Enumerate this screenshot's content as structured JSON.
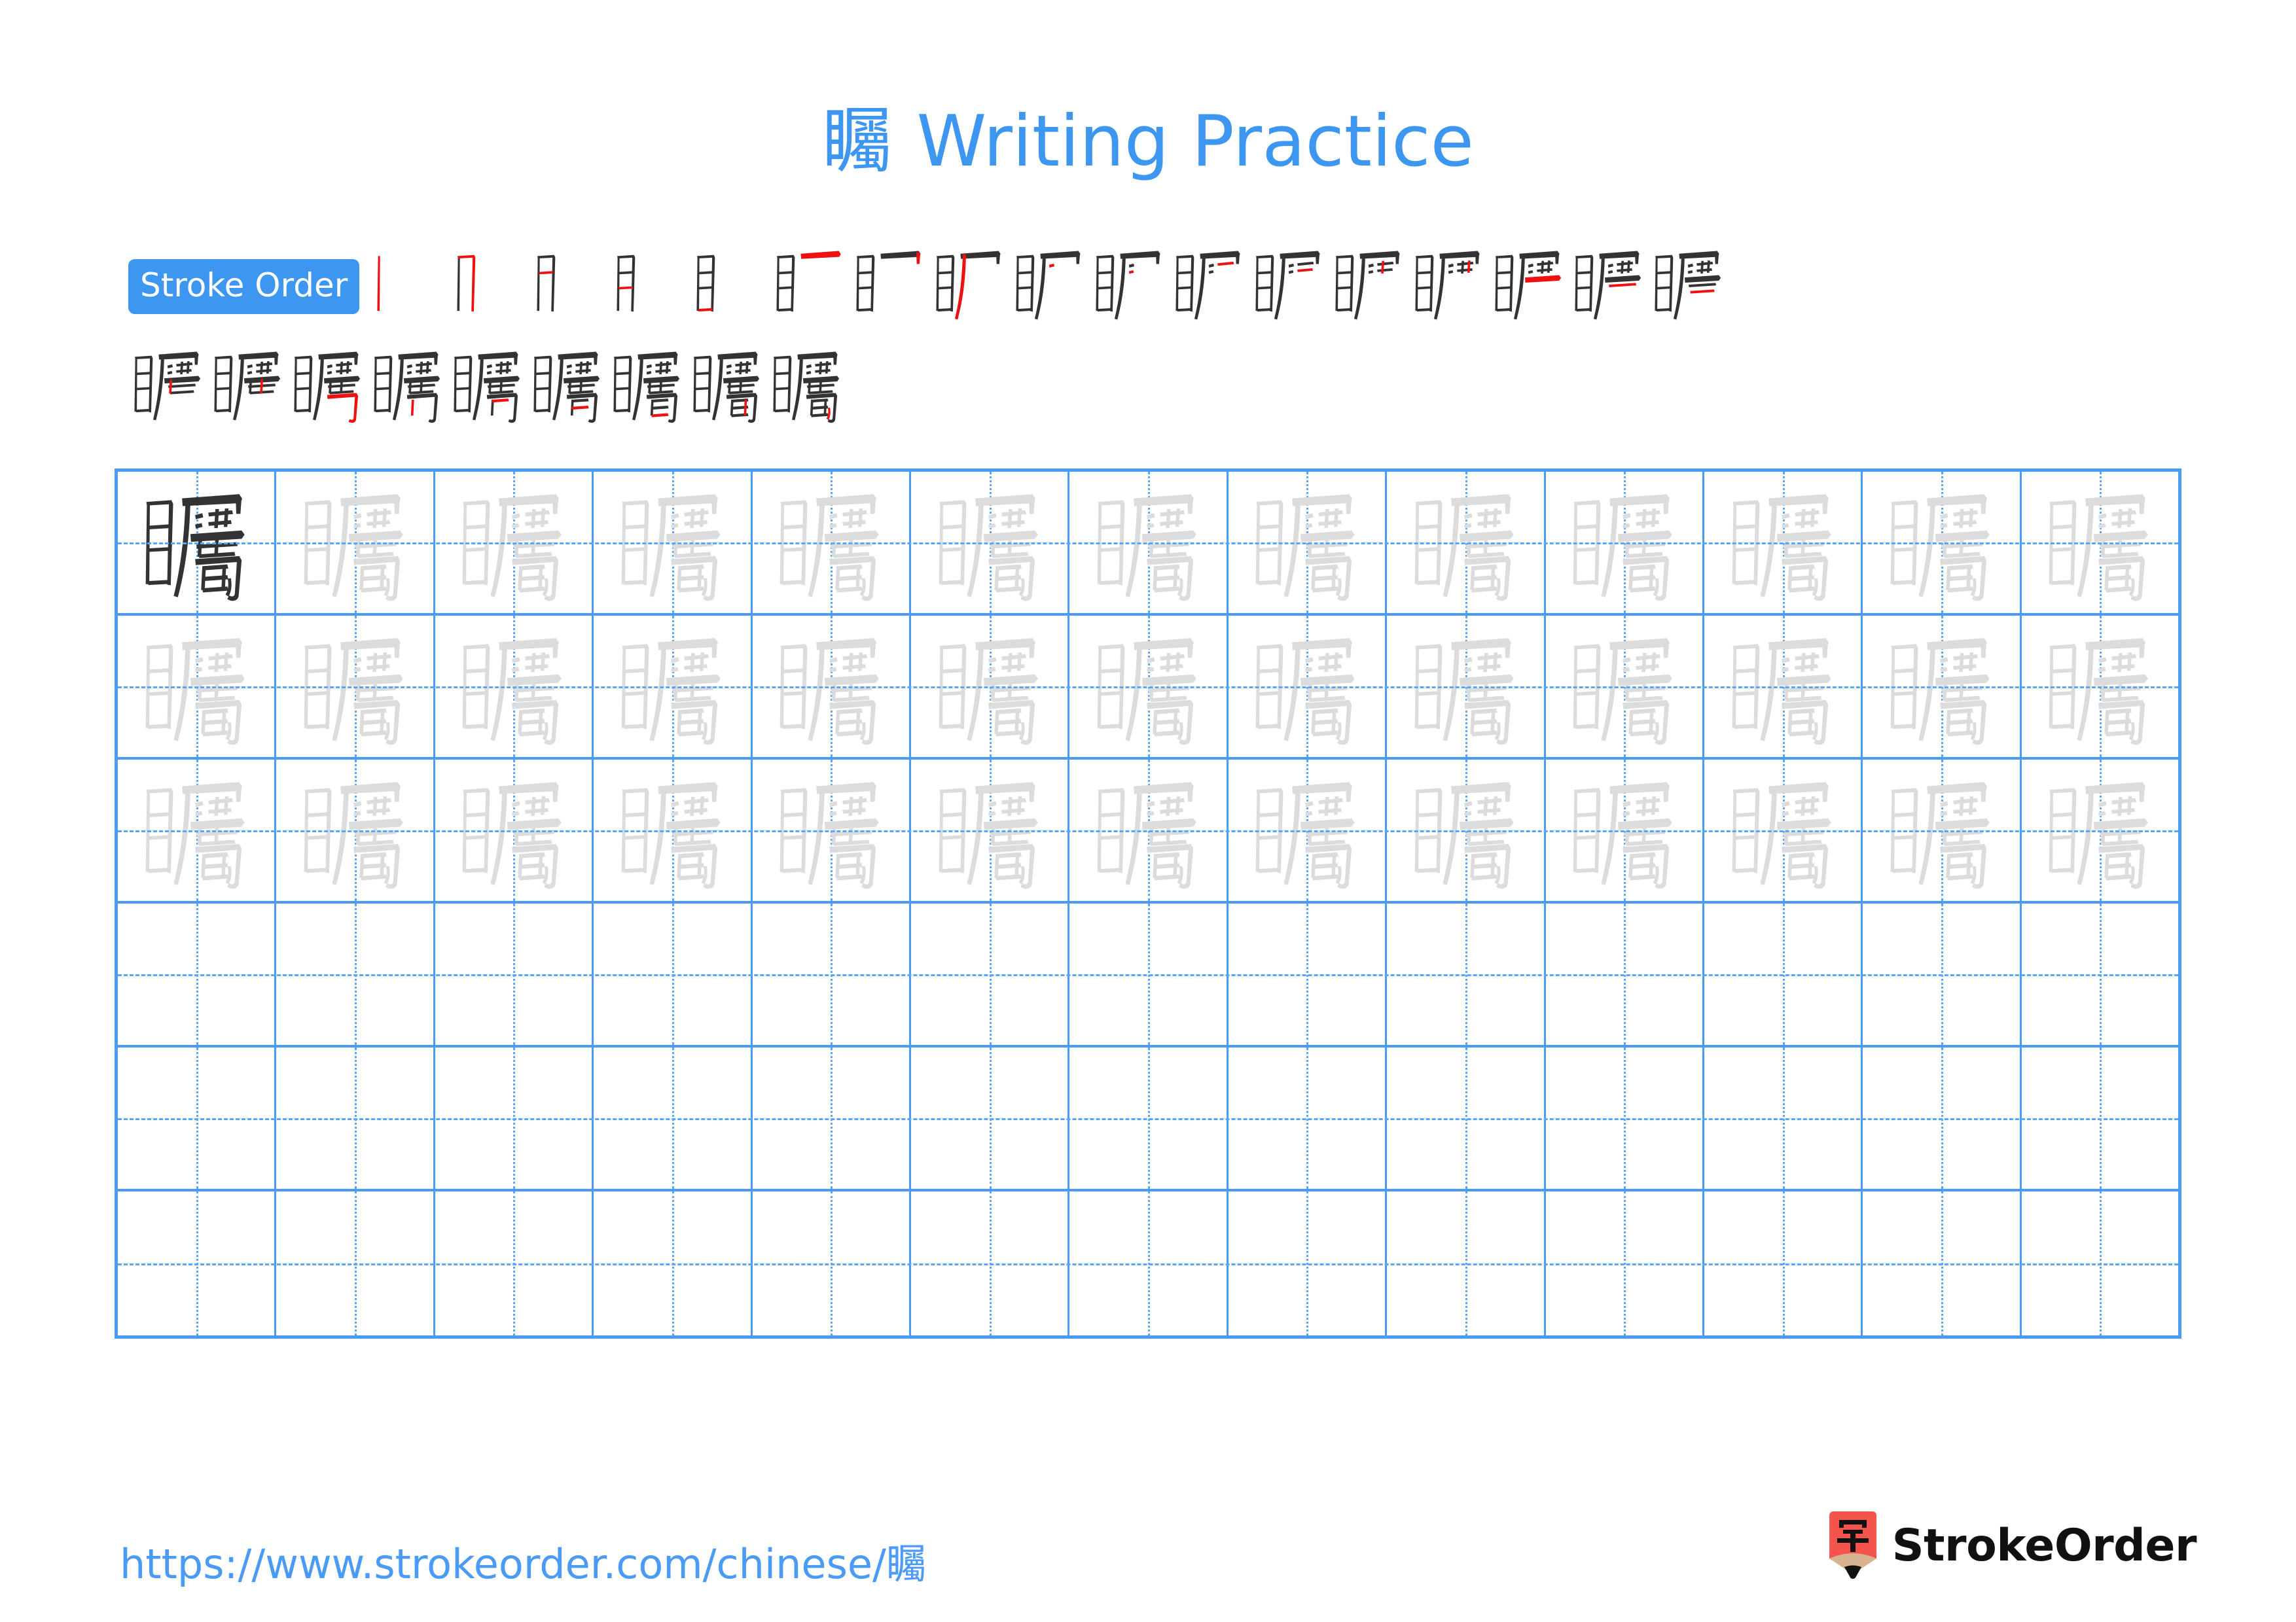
{
  "page": {
    "character": "矚",
    "title_suffix": "Writing Practice",
    "title_full": "矚 Writing Practice",
    "accent_color": "#3d96f0",
    "grid_line_color": "#4a9bf5",
    "trace_color": "#dcdcdc",
    "ink_color": "#333333",
    "highlight_stroke_color": "#ee1111"
  },
  "stroke_order": {
    "badge_label": "Stroke Order",
    "total_strokes": 26,
    "rows": [
      {
        "steps": [
          1,
          2,
          3,
          4,
          5,
          6,
          7,
          8,
          9,
          10,
          11,
          12,
          13,
          14,
          15,
          16,
          17
        ]
      },
      {
        "steps": [
          18,
          19,
          20,
          21,
          22,
          23,
          24,
          25,
          26
        ]
      }
    ]
  },
  "practice_grid": {
    "columns": 13,
    "rows": 6,
    "filled_rows": 3,
    "empty_rows": 3,
    "cells": [
      [
        "dark",
        "light",
        "light",
        "light",
        "light",
        "light",
        "light",
        "light",
        "light",
        "light",
        "light",
        "light",
        "light"
      ],
      [
        "light",
        "light",
        "light",
        "light",
        "light",
        "light",
        "light",
        "light",
        "light",
        "light",
        "light",
        "light",
        "light"
      ],
      [
        "light",
        "light",
        "light",
        "light",
        "light",
        "light",
        "light",
        "light",
        "light",
        "light",
        "light",
        "light",
        "light"
      ],
      [
        "empty",
        "empty",
        "empty",
        "empty",
        "empty",
        "empty",
        "empty",
        "empty",
        "empty",
        "empty",
        "empty",
        "empty",
        "empty"
      ],
      [
        "empty",
        "empty",
        "empty",
        "empty",
        "empty",
        "empty",
        "empty",
        "empty",
        "empty",
        "empty",
        "empty",
        "empty",
        "empty"
      ],
      [
        "empty",
        "empty",
        "empty",
        "empty",
        "empty",
        "empty",
        "empty",
        "empty",
        "empty",
        "empty",
        "empty",
        "empty",
        "empty"
      ]
    ]
  },
  "footer": {
    "url": "https://www.strokeorder.com/chinese/矚",
    "brand_name": "StrokeOrder",
    "brand_mark_character": "字",
    "brand_mark_color": "#f4544c",
    "brand_pencil_wood_color": "#d7b391"
  }
}
